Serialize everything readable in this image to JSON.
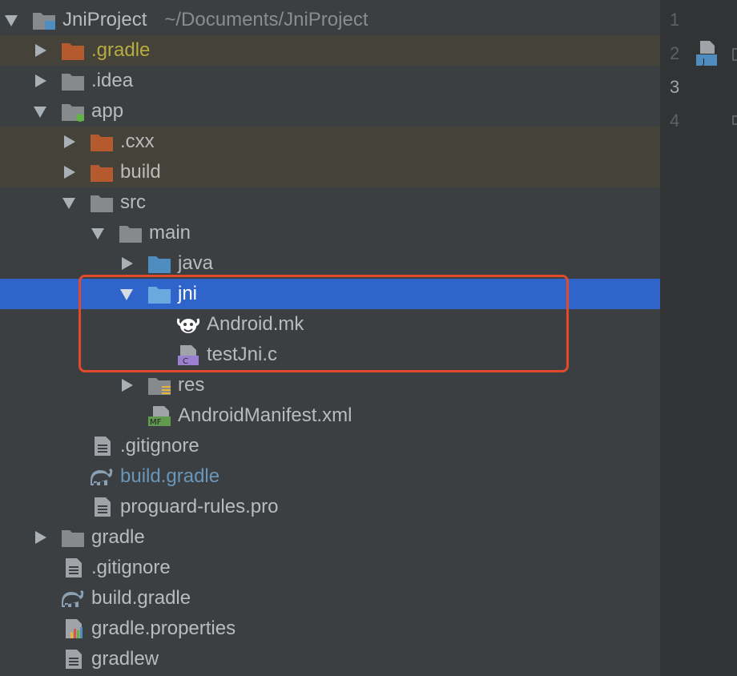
{
  "colors": {
    "panel_bg": "#3c3f41",
    "excluded_bg": "#45423a",
    "selected_bg": "#2f65ca",
    "highlight_border": "#e24a2b",
    "gradle_excluded_text": "#b7ac3f",
    "modified_text": "#6897bb",
    "folder_excluded": "#b5592e",
    "folder_plain": "#868a8d",
    "folder_source": "#4f8cbf"
  },
  "project": {
    "name": "JniProject",
    "path": "~/Documents/JniProject"
  },
  "tree": {
    "gradle_hidden": ".gradle",
    "idea": ".idea",
    "app": "app",
    "cxx": ".cxx",
    "build": "build",
    "src": "src",
    "main": "main",
    "java": "java",
    "jni": "jni",
    "android_mk": "Android.mk",
    "test_jni_c": "testJni.c",
    "res": "res",
    "manifest": "AndroidManifest.xml",
    "app_gitignore": ".gitignore",
    "app_build_gradle": "build.gradle",
    "proguard": "proguard-rules.pro",
    "gradle_dir": "gradle",
    "root_gitignore": ".gitignore",
    "root_build_gradle": "build.gradle",
    "gradle_properties": "gradle.properties",
    "gradlew": "gradlew"
  },
  "gutter": {
    "lines": [
      "1",
      "2",
      "3",
      "4"
    ],
    "current_line": "3"
  },
  "icons": {
    "file_type_badges": {
      "java_badge": "J",
      "c_badge": "C",
      "manifest_badge": "MF"
    }
  }
}
